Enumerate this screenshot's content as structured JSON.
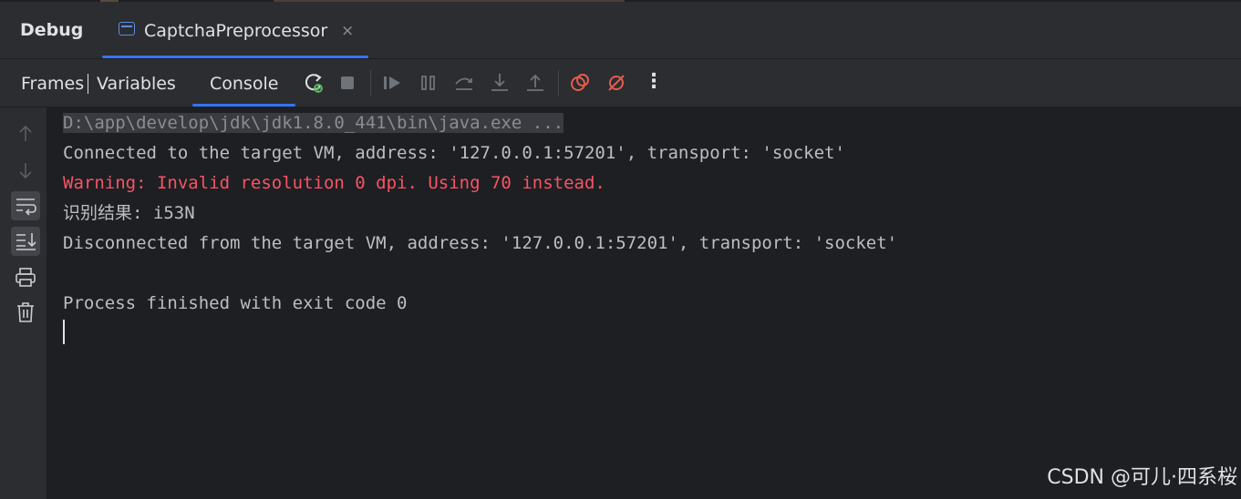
{
  "header": {
    "title": "Debug",
    "tab_label": "CaptchaPreprocessor",
    "tab_close": "×"
  },
  "toolbar": {
    "frames_label": "Frames",
    "variables_label": "Variables",
    "console_label": "Console",
    "more_label": "⋮"
  },
  "console": {
    "lines": [
      "D:\\app\\develop\\jdk\\jdk1.8.0_441\\bin\\java.exe ...",
      "Connected to the target VM, address: '127.0.0.1:57201', transport: 'socket'",
      "Warning: Invalid resolution 0 dpi. Using 70 instead.",
      "识别结果: i53N",
      "Disconnected from the target VM, address: '127.0.0.1:57201', transport: 'socket'",
      "",
      "Process finished with exit code 0"
    ]
  },
  "watermark": "CSDN @可儿·四系桜",
  "colors": {
    "accent": "#3574f0",
    "error_text": "#f75464",
    "console_bg": "#1e1f22",
    "panel_bg": "#2b2d30",
    "rerun_icon": "#5fb865",
    "breakpoint_icon": "#e55b4d"
  }
}
